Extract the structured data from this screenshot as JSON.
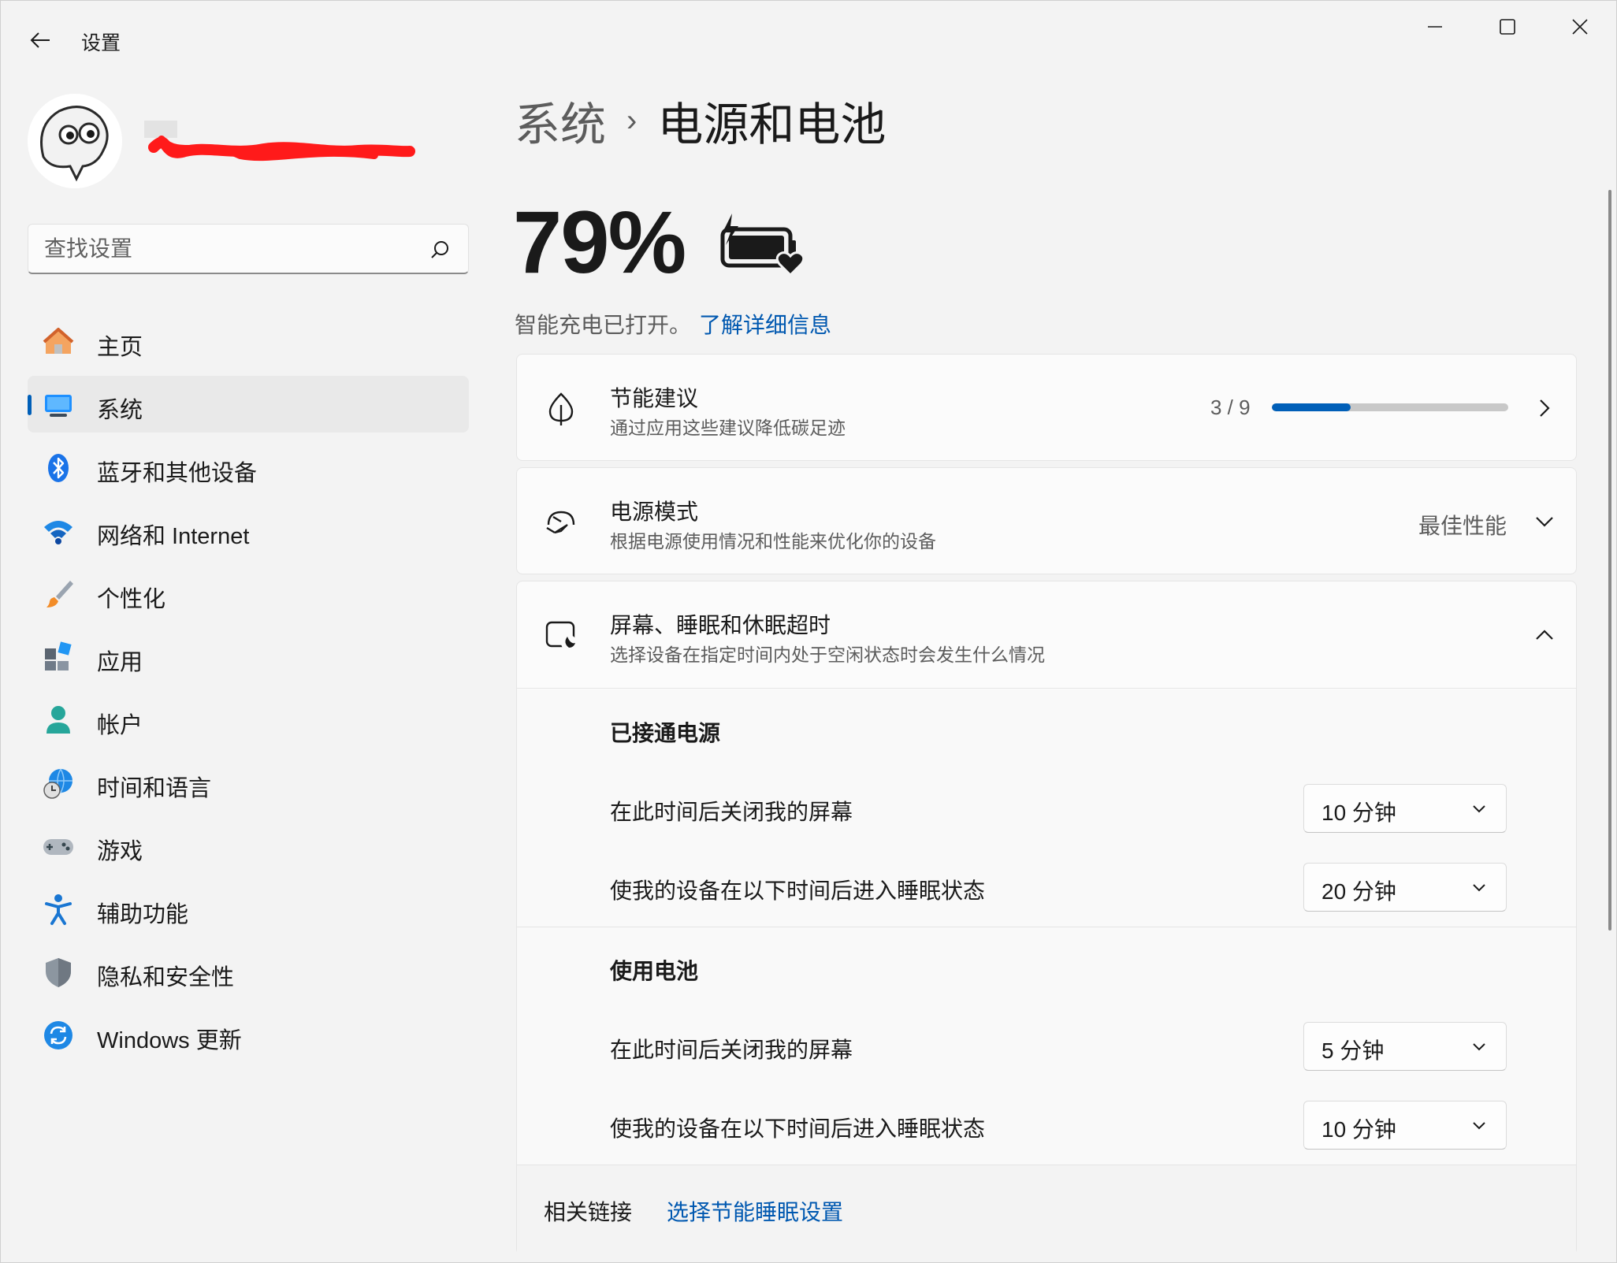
{
  "app": {
    "title": "设置"
  },
  "window_controls": {
    "minimize": "minimize-icon",
    "maximize": "maximize-icon",
    "close": "close-icon"
  },
  "profile": {
    "username": ""
  },
  "search": {
    "placeholder": "查找设置"
  },
  "sidebar": {
    "items": [
      {
        "label": "主页",
        "icon": "home-icon",
        "active": false
      },
      {
        "label": "系统",
        "icon": "system-icon",
        "active": true
      },
      {
        "label": "蓝牙和其他设备",
        "icon": "bluetooth-icon",
        "active": false
      },
      {
        "label": "网络和 Internet",
        "icon": "wifi-icon",
        "active": false
      },
      {
        "label": "个性化",
        "icon": "brush-icon",
        "active": false
      },
      {
        "label": "应用",
        "icon": "apps-icon",
        "active": false
      },
      {
        "label": "帐户",
        "icon": "account-icon",
        "active": false
      },
      {
        "label": "时间和语言",
        "icon": "globe-clock-icon",
        "active": false
      },
      {
        "label": "游戏",
        "icon": "gamepad-icon",
        "active": false
      },
      {
        "label": "辅助功能",
        "icon": "accessibility-icon",
        "active": false
      },
      {
        "label": "隐私和安全性",
        "icon": "shield-icon",
        "active": false
      },
      {
        "label": "Windows 更新",
        "icon": "update-icon",
        "active": false
      }
    ]
  },
  "breadcrumb": {
    "parent": "系统",
    "separator": "›",
    "current": "电源和电池"
  },
  "battery": {
    "percent": "79%",
    "status": "智能充电已打开。",
    "learn_more": "了解详细信息"
  },
  "energy_recommendations": {
    "title": "节能建议",
    "subtitle": "通过应用这些建议降低碳足迹",
    "progress_text": "3 / 9",
    "progress_fraction": 0.333
  },
  "power_mode": {
    "title": "电源模式",
    "subtitle": "根据电源使用情况和性能来优化你的设备",
    "value": "最佳性能"
  },
  "screen_sleep": {
    "title": "屏幕、睡眠和休眠超时",
    "subtitle": "选择设备在指定时间内处于空闲状态时会发生什么情况",
    "plugged_in": {
      "heading": "已接通电源",
      "screen_off_label": "在此时间后关闭我的屏幕",
      "screen_off_value": "10 分钟",
      "sleep_label": "使我的设备在以下时间后进入睡眠状态",
      "sleep_value": "20 分钟"
    },
    "on_battery": {
      "heading": "使用电池",
      "screen_off_label": "在此时间后关闭我的屏幕",
      "screen_off_value": "5 分钟",
      "sleep_label": "使我的设备在以下时间后进入睡眠状态",
      "sleep_value": "10 分钟"
    }
  },
  "related": {
    "label": "相关链接",
    "link": "选择节能睡眠设置"
  },
  "colors": {
    "accent": "#005fb8",
    "link": "#0058b0",
    "background": "#f3f3f3",
    "card": "#fbfbfb"
  }
}
